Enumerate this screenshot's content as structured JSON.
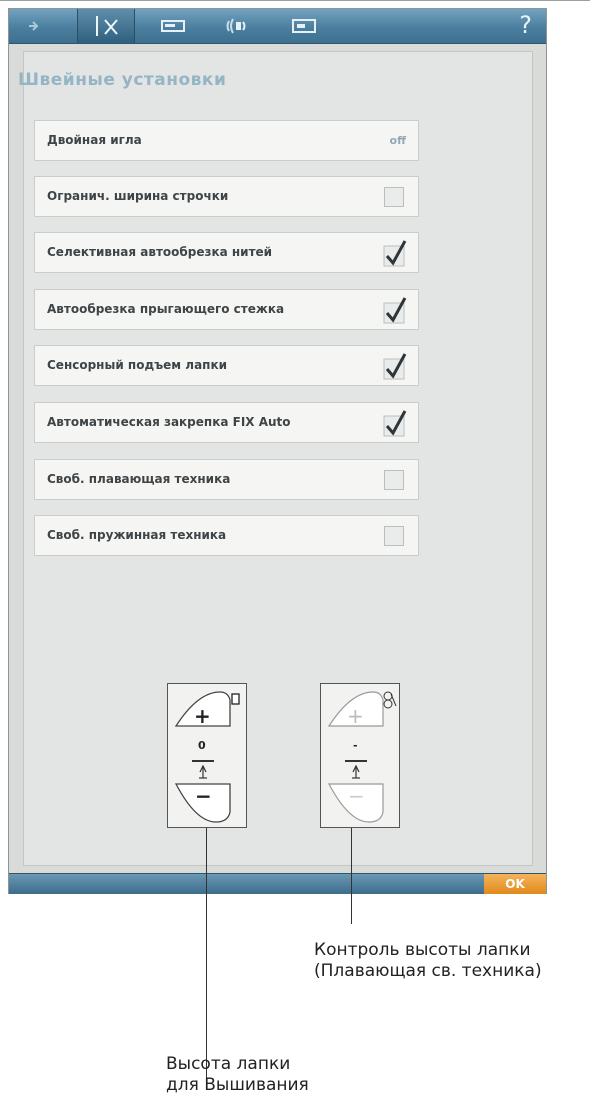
{
  "toolbar": {
    "tabs": [
      {
        "icon": "embroidery-tab-icon"
      },
      {
        "icon": "sewing-settings-tab-icon"
      },
      {
        "icon": "machine-settings-tab-icon"
      },
      {
        "icon": "sound-settings-tab-icon"
      },
      {
        "icon": "machine-info-tab-icon"
      }
    ],
    "help_label": "?"
  },
  "panel": {
    "title": "Швейные установки",
    "rows": [
      {
        "label": "Двойная игла",
        "value": "off",
        "checked": null
      },
      {
        "label": "Огранич. ширина строчки",
        "checked": false
      },
      {
        "label": "Селективная автообрезка нитей",
        "checked": true
      },
      {
        "label": "Автообрезка прыгающего стежка",
        "checked": true
      },
      {
        "label": "Сенсорный подъем лапки",
        "checked": true
      },
      {
        "label": "Автоматическая закрепка FIX Auto",
        "checked": true
      },
      {
        "label": "Своб. плавающая техника",
        "checked": false
      },
      {
        "label": "Своб. пружинная техника",
        "checked": false
      }
    ]
  },
  "controls": {
    "left": {
      "plus": "+",
      "minus": "−",
      "value": "0",
      "corner_icon": "presser-foot-icon"
    },
    "right": {
      "plus": "+",
      "minus": "−",
      "value": "-",
      "corner_icon": "spring-foot-icon"
    }
  },
  "footer": {
    "ok_label": "OK"
  },
  "captions": {
    "right_line1": "Контроль высоты лапки",
    "right_line2": "(Плавающая св. техника)",
    "left_line1": "Высота лапки",
    "left_line2": "для Вышивания"
  },
  "colors": {
    "accent": "#4b7f9f",
    "ok": "#e08a1c",
    "title": "#93b5c4"
  }
}
